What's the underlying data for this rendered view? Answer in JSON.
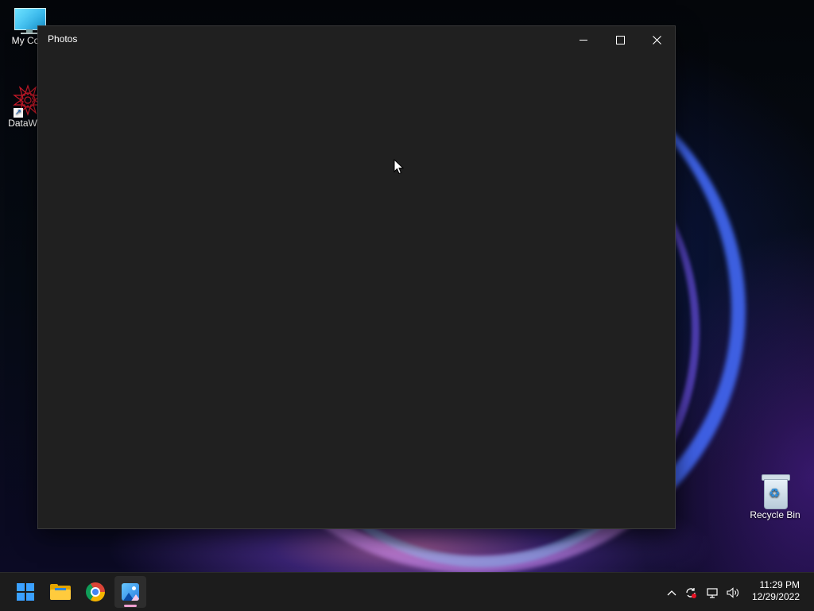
{
  "desktop": {
    "icons": [
      {
        "label": "My Com",
        "icon": "computer-icon"
      },
      {
        "label": "DataWag",
        "icon": "datawag-app-icon"
      },
      {
        "label": "Recycle Bin",
        "icon": "recycle-bin-icon"
      }
    ]
  },
  "window": {
    "title": "Photos",
    "controls": {
      "minimize": "minimize-icon",
      "maximize": "maximize-icon",
      "close": "close-icon"
    }
  },
  "taskbar": {
    "apps": [
      {
        "name": "Start",
        "icon": "windows-start-icon"
      },
      {
        "name": "File Explorer",
        "icon": "folder-icon"
      },
      {
        "name": "Google Chrome",
        "icon": "chrome-icon"
      },
      {
        "name": "Photos",
        "icon": "photos-icon",
        "active": true
      }
    ],
    "tray": {
      "icons": [
        "chevron-up-icon",
        "sync-icon",
        "network-icon",
        "volume-icon"
      ],
      "time": "11:29 PM",
      "date": "12/29/2022"
    },
    "accent_color": "#f0a0d0"
  }
}
